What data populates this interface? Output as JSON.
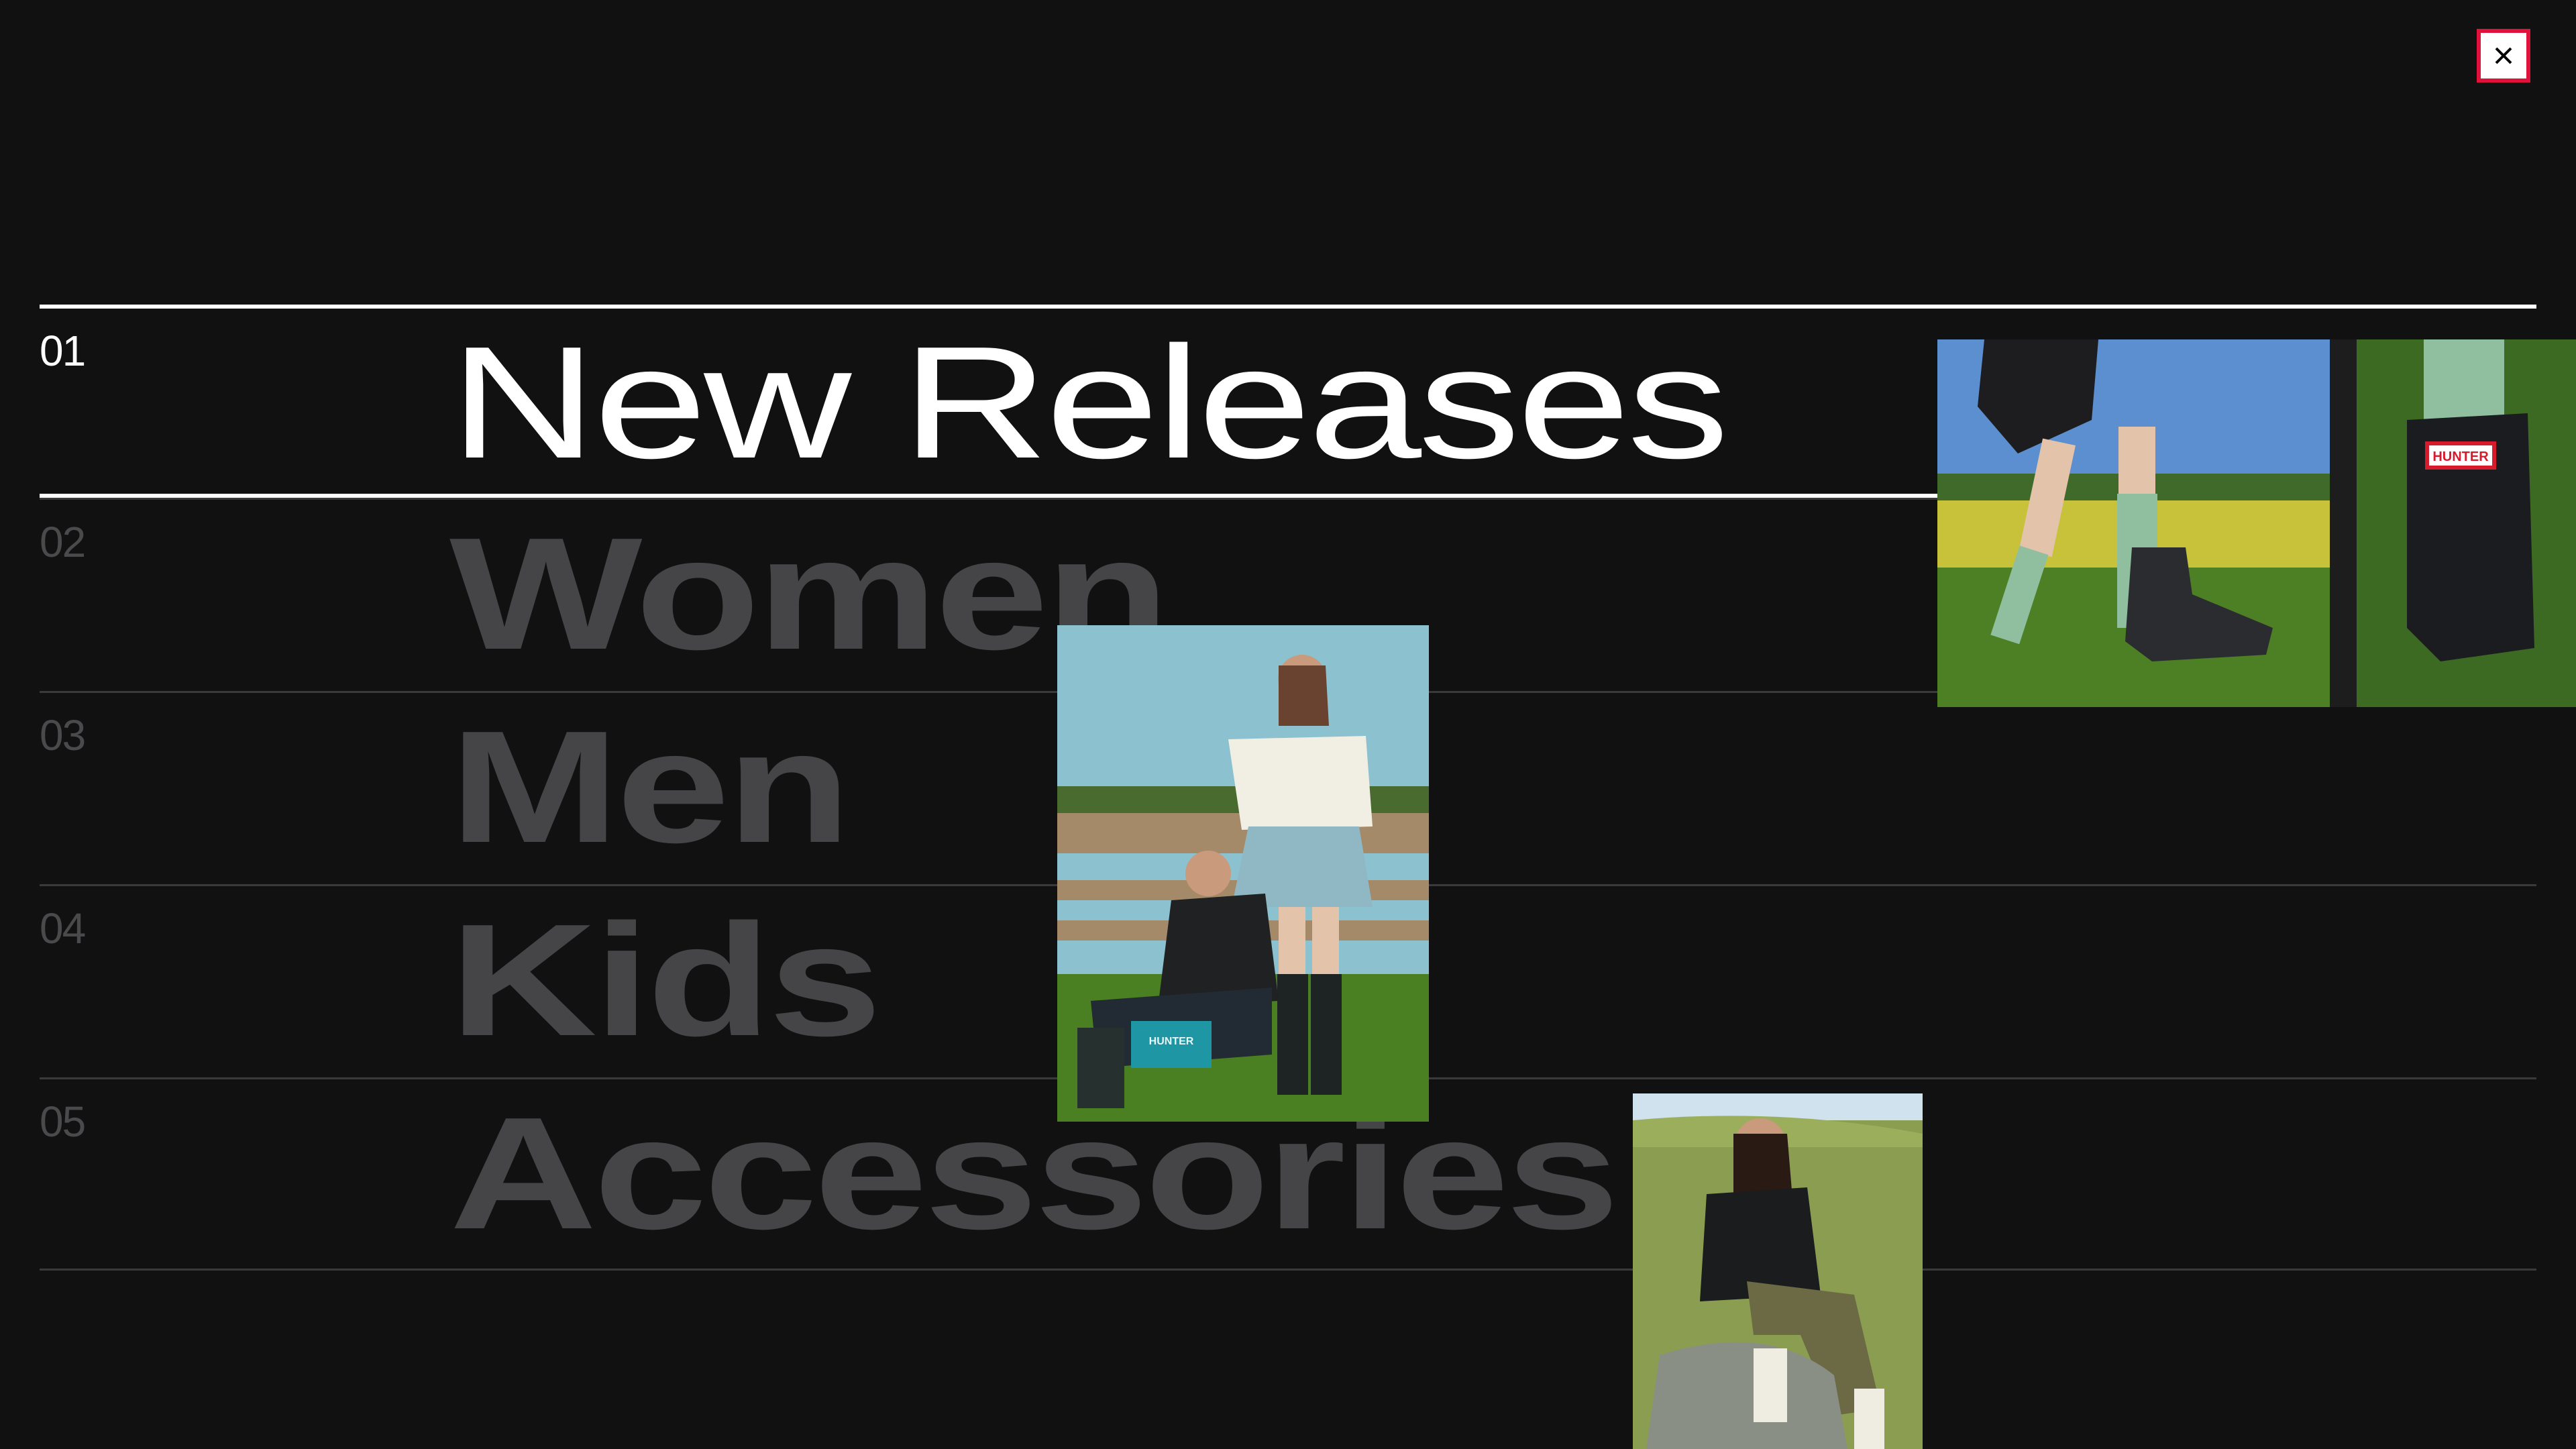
{
  "close_button": {
    "label": "×",
    "icon": "close-icon"
  },
  "menu": {
    "items": [
      {
        "number": "01",
        "label": "New Releases",
        "active": true
      },
      {
        "number": "02",
        "label": "Women",
        "active": false
      },
      {
        "number": "03",
        "label": "Men",
        "active": false
      },
      {
        "number": "04",
        "label": "Kids",
        "active": false
      },
      {
        "number": "05",
        "label": "Accessories",
        "active": false
      }
    ]
  },
  "images": [
    {
      "name": "boots-walking-field-photo",
      "boot_tag": "HUNTER"
    },
    {
      "name": "two-women-fence-photo",
      "bag_tag": "HUNTER"
    },
    {
      "name": "woman-sitting-rock-photo"
    }
  ],
  "colors": {
    "background": "#111112",
    "active_text": "#ffffff",
    "inactive_text": "#454547",
    "close_border": "#e0123c"
  }
}
